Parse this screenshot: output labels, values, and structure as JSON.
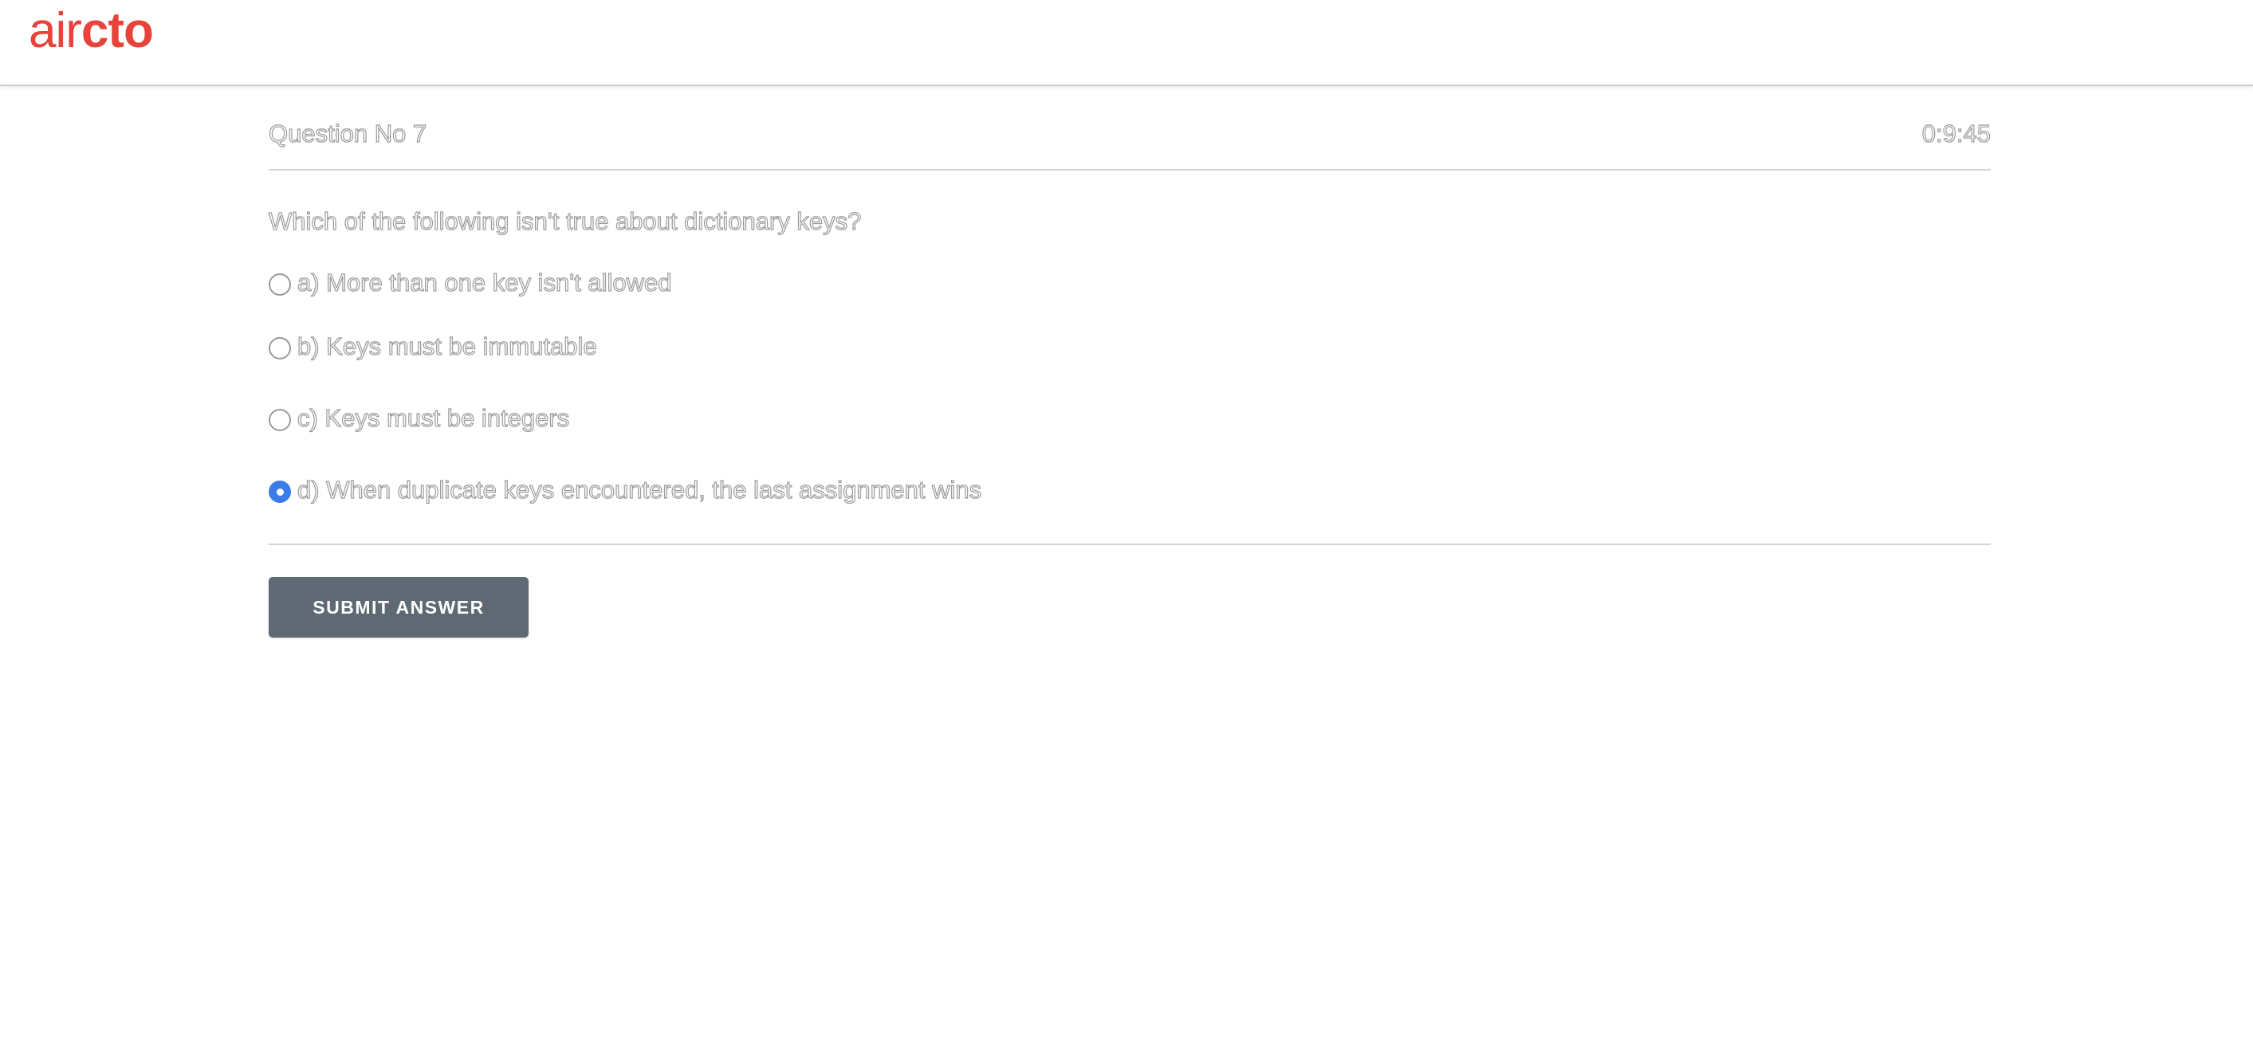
{
  "header": {
    "logo_light": "air",
    "logo_bold": "cto",
    "brand_color": "#e8433a"
  },
  "question": {
    "number_label": "Question No 7",
    "timer": "0:9:45",
    "text": "Which of the following isn't true about dictionary keys?",
    "options": [
      {
        "label": "a) More than one key isn't allowed",
        "selected": false
      },
      {
        "label": "b) Keys must be immutable",
        "selected": false
      },
      {
        "label": "c) Keys must be integers",
        "selected": false
      },
      {
        "label": "d) When duplicate keys encountered, the last assignment wins",
        "selected": true
      }
    ]
  },
  "actions": {
    "submit_label": "SUBMIT ANSWER"
  },
  "colors": {
    "accent": "#3a7de8",
    "button_bg": "#5e6974"
  }
}
